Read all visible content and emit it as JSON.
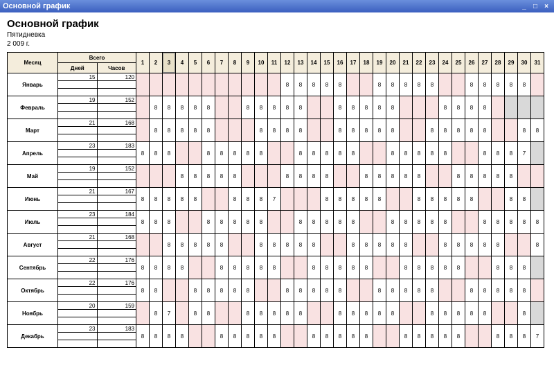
{
  "window": {
    "title": "Основной график"
  },
  "header": {
    "title": "Основной график",
    "subtitle1": "Пятидневка",
    "subtitle2": "2 009 г."
  },
  "columns": {
    "month": "Месяц",
    "total": "Всего",
    "days": "Дней",
    "hours": "Часов",
    "day_numbers": [
      "1",
      "2",
      "3",
      "4",
      "5",
      "6",
      "7",
      "8",
      "9",
      "10",
      "11",
      "12",
      "13",
      "14",
      "15",
      "16",
      "17",
      "18",
      "19",
      "20",
      "21",
      "22",
      "23",
      "24",
      "25",
      "26",
      "27",
      "28",
      "29",
      "30",
      "31"
    ],
    "selected_day": 3
  },
  "months": [
    {
      "name": "Январь",
      "days": 15,
      "hours": 120,
      "weekends": [
        1,
        2,
        3,
        4,
        5,
        6,
        7,
        8,
        9,
        10,
        11,
        17,
        18,
        24,
        25,
        31
      ],
      "na": [],
      "cells": {
        "12": "8",
        "13": "8",
        "14": "8",
        "15": "8",
        "16": "8",
        "19": "8",
        "20": "8",
        "21": "8",
        "22": "8",
        "23": "8",
        "26": "8",
        "27": "8",
        "28": "8",
        "29": "8",
        "30": "8"
      }
    },
    {
      "name": "Февраль",
      "days": 19,
      "hours": 152,
      "weekends": [
        1,
        7,
        8,
        14,
        15,
        21,
        22,
        23,
        28
      ],
      "na": [
        29,
        30,
        31
      ],
      "cells": {
        "2": "8",
        "3": "8",
        "4": "8",
        "5": "8",
        "6": "8",
        "9": "8",
        "10": "8",
        "11": "8",
        "12": "8",
        "13": "8",
        "16": "8",
        "17": "8",
        "18": "8",
        "19": "8",
        "20": "8",
        "24": "8",
        "25": "8",
        "26": "8",
        "27": "8"
      }
    },
    {
      "name": "Март",
      "days": 21,
      "hours": 168,
      "weekends": [
        1,
        7,
        8,
        9,
        14,
        15,
        21,
        22,
        28,
        29
      ],
      "na": [],
      "cells": {
        "2": "8",
        "3": "8",
        "4": "8",
        "5": "8",
        "6": "8",
        "10": "8",
        "11": "8",
        "12": "8",
        "13": "8",
        "16": "8",
        "17": "8",
        "18": "8",
        "19": "8",
        "20": "8",
        "23": "8",
        "24": "8",
        "25": "8",
        "26": "8",
        "27": "8",
        "30": "8",
        "31": "8"
      }
    },
    {
      "name": "Апрель",
      "days": 23,
      "hours": 183,
      "weekends": [
        4,
        5,
        11,
        12,
        18,
        19,
        25,
        26
      ],
      "na": [
        31
      ],
      "cells": {
        "1": "8",
        "2": "8",
        "3": "8",
        "6": "8",
        "7": "8",
        "8": "8",
        "9": "8",
        "10": "8",
        "13": "8",
        "14": "8",
        "15": "8",
        "16": "8",
        "17": "8",
        "20": "8",
        "21": "8",
        "22": "8",
        "23": "8",
        "24": "8",
        "27": "8",
        "28": "8",
        "29": "8",
        "30": "7"
      }
    },
    {
      "name": "Май",
      "days": 19,
      "hours": 152,
      "weekends": [
        1,
        2,
        3,
        9,
        10,
        11,
        16,
        17,
        23,
        24,
        30,
        31
      ],
      "na": [],
      "cells": {
        "4": "8",
        "5": "8",
        "6": "8",
        "7": "8",
        "8": "8",
        "12": "8",
        "13": "8",
        "14": "8",
        "15": "8",
        "18": "8",
        "19": "8",
        "20": "8",
        "21": "8",
        "22": "8",
        "25": "8",
        "26": "8",
        "27": "8",
        "28": "8",
        "29": "8"
      }
    },
    {
      "name": "Июнь",
      "days": 21,
      "hours": 167,
      "weekends": [
        6,
        7,
        12,
        13,
        14,
        20,
        21,
        27,
        28
      ],
      "na": [
        31
      ],
      "cells": {
        "1": "8",
        "2": "8",
        "3": "8",
        "4": "8",
        "5": "8",
        "8": "8",
        "9": "8",
        "10": "8",
        "11": "7",
        "15": "8",
        "16": "8",
        "17": "8",
        "18": "8",
        "19": "8",
        "22": "8",
        "23": "8",
        "24": "8",
        "25": "8",
        "26": "8",
        "29": "8",
        "30": "8"
      }
    },
    {
      "name": "Июль",
      "days": 23,
      "hours": 184,
      "weekends": [
        4,
        5,
        11,
        12,
        18,
        19,
        25,
        26
      ],
      "na": [],
      "cells": {
        "1": "8",
        "2": "8",
        "3": "8",
        "6": "8",
        "7": "8",
        "8": "8",
        "9": "8",
        "10": "8",
        "13": "8",
        "14": "8",
        "15": "8",
        "16": "8",
        "17": "8",
        "20": "8",
        "21": "8",
        "22": "8",
        "23": "8",
        "24": "8",
        "27": "8",
        "28": "8",
        "29": "8",
        "30": "8",
        "31": "8"
      }
    },
    {
      "name": "Август",
      "days": 21,
      "hours": 168,
      "weekends": [
        1,
        2,
        8,
        9,
        15,
        16,
        22,
        23,
        29,
        30
      ],
      "na": [],
      "cells": {
        "3": "8",
        "4": "8",
        "5": "8",
        "6": "8",
        "7": "8",
        "10": "8",
        "11": "8",
        "12": "8",
        "13": "8",
        "14": "8",
        "17": "8",
        "18": "8",
        "19": "8",
        "20": "8",
        "21": "8",
        "24": "8",
        "25": "8",
        "26": "8",
        "27": "8",
        "28": "8",
        "31": "8"
      }
    },
    {
      "name": "Сентябрь",
      "days": 22,
      "hours": 176,
      "weekends": [
        5,
        6,
        12,
        13,
        19,
        20,
        26,
        27
      ],
      "na": [
        31
      ],
      "cells": {
        "1": "8",
        "2": "8",
        "3": "8",
        "4": "8",
        "7": "8",
        "8": "8",
        "9": "8",
        "10": "8",
        "11": "8",
        "14": "8",
        "15": "8",
        "16": "8",
        "17": "8",
        "18": "8",
        "21": "8",
        "22": "8",
        "23": "8",
        "24": "8",
        "25": "8",
        "28": "8",
        "29": "8",
        "30": "8"
      }
    },
    {
      "name": "Октябрь",
      "days": 22,
      "hours": 176,
      "weekends": [
        3,
        4,
        10,
        11,
        17,
        18,
        24,
        25,
        31
      ],
      "na": [],
      "cells": {
        "1": "8",
        "2": "8",
        "5": "8",
        "6": "8",
        "7": "8",
        "8": "8",
        "9": "8",
        "12": "8",
        "13": "8",
        "14": "8",
        "15": "8",
        "16": "8",
        "19": "8",
        "20": "8",
        "21": "8",
        "22": "8",
        "23": "8",
        "26": "8",
        "27": "8",
        "28": "8",
        "29": "8",
        "30": "8"
      }
    },
    {
      "name": "Ноябрь",
      "days": 20,
      "hours": 159,
      "weekends": [
        1,
        4,
        7,
        8,
        14,
        15,
        21,
        22,
        28,
        29
      ],
      "na": [
        31
      ],
      "cells": {
        "2": "8",
        "3": "7",
        "5": "8",
        "6": "8",
        "9": "8",
        "10": "8",
        "11": "8",
        "12": "8",
        "13": "8",
        "16": "8",
        "17": "8",
        "18": "8",
        "19": "8",
        "20": "8",
        "23": "8",
        "24": "8",
        "25": "8",
        "26": "8",
        "27": "8",
        "30": "8"
      }
    },
    {
      "name": "Декабрь",
      "days": 23,
      "hours": 183,
      "weekends": [
        5,
        6,
        12,
        13,
        19,
        20,
        26,
        27
      ],
      "na": [],
      "cells": {
        "1": "8",
        "2": "8",
        "3": "8",
        "4": "8",
        "7": "8",
        "8": "8",
        "9": "8",
        "10": "8",
        "11": "8",
        "14": "8",
        "15": "8",
        "16": "8",
        "17": "8",
        "18": "8",
        "21": "8",
        "22": "8",
        "23": "8",
        "24": "8",
        "25": "8",
        "28": "8",
        "29": "8",
        "30": "8",
        "31": "7"
      }
    }
  ]
}
